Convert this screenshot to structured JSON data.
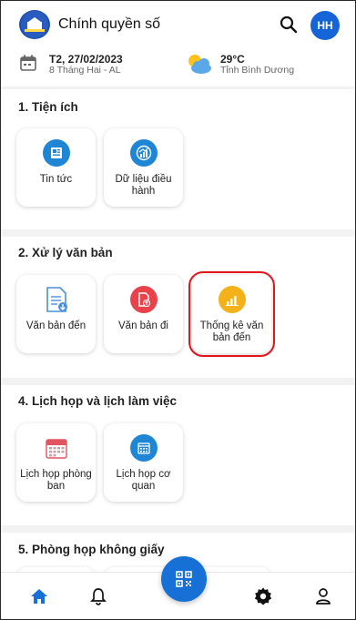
{
  "header": {
    "title": "Chính quyền số",
    "avatar_initials": "HH",
    "date_main": "T2, 27/02/2023",
    "date_sub": "8 Tháng Hai - AL",
    "temperature": "29°C",
    "location": "Tỉnh Bình Dương"
  },
  "sections": [
    {
      "title": "1. Tiện ích",
      "cards": [
        {
          "label": "Tin tức",
          "icon": "news-icon"
        },
        {
          "label": "Dữ liệu điều hành",
          "icon": "analytics-icon"
        }
      ]
    },
    {
      "title": "2. Xử lý văn bản",
      "cards": [
        {
          "label": "Văn bản đến",
          "icon": "incoming-document-icon"
        },
        {
          "label": "Văn bản đi",
          "icon": "outgoing-document-icon"
        },
        {
          "label": "Thống kê văn bản đến",
          "icon": "statistics-icon"
        }
      ]
    },
    {
      "title": "4. Lịch họp và lịch làm việc",
      "cards": [
        {
          "label": "Lịch họp phòng ban",
          "icon": "calendar-icon"
        },
        {
          "label": "Lịch họp cơ quan",
          "icon": "calendar-grid-icon"
        }
      ]
    },
    {
      "title": "5. Phòng họp không giấy",
      "cards": []
    }
  ],
  "colors": {
    "accent": "#1670d6",
    "highlight": "#e3141c",
    "news": "#1f86d6",
    "outgoing": "#e8434a",
    "stats": "#f3b21a"
  },
  "bottom_nav": [
    "home-icon",
    "bell-icon",
    "qr-icon",
    "gear-icon",
    "user-icon"
  ]
}
